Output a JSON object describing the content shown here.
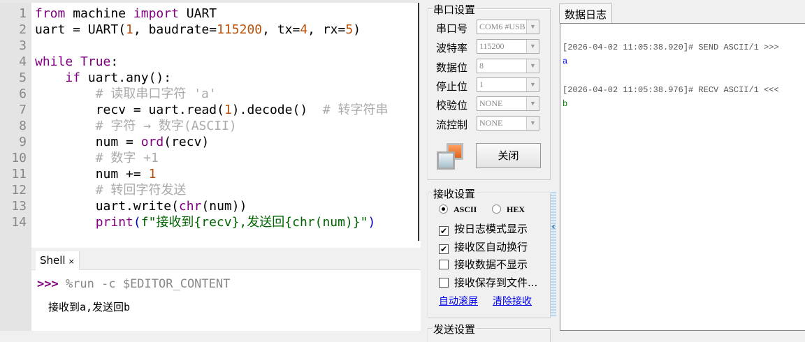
{
  "editor": {
    "line_numbers": [
      "1",
      "2",
      "3",
      "4",
      "5",
      "6",
      "7",
      "8",
      "9",
      "10",
      "11",
      "12",
      "13",
      "14"
    ],
    "code": {
      "l1": [
        "from",
        " machine ",
        "import",
        " UART"
      ],
      "l2": [
        "uart = UART(",
        "1",
        ", baudrate=",
        "115200",
        ", tx=",
        "4",
        ", rx=",
        "5",
        ")"
      ],
      "l4": [
        "while",
        " ",
        "True",
        ":"
      ],
      "l5": [
        "    ",
        "if",
        " uart.any():"
      ],
      "l6": "        # 读取串口字符 'a'",
      "l7": [
        "        recv = uart.read(",
        "1",
        ").decode()  ",
        "# 转字符串"
      ],
      "l8": "        # 字符 → 数字(ASCII)",
      "l9": [
        "        num = ",
        "ord",
        "(recv)"
      ],
      "l10": "        # 数字 +1",
      "l11": [
        "        num += ",
        "1"
      ],
      "l12": "        # 转回字符发送",
      "l13": [
        "        uart.write(",
        "chr",
        "(num))"
      ],
      "l14": [
        "        ",
        "print",
        "(",
        "f\"接收到{recv},发送回{chr(num)}\"",
        ")"
      ]
    }
  },
  "shell": {
    "tab_label": "Shell",
    "close": "×",
    "prompt": ">>>",
    "command": " %run -c $EDITOR_CONTENT",
    "output": "接收到a,发送回b"
  },
  "serial": {
    "group_port": "串口设置",
    "fields": [
      {
        "label": "串口号",
        "value": "COM6 #USB"
      },
      {
        "label": "波特率",
        "value": "115200"
      },
      {
        "label": "数据位",
        "value": "8"
      },
      {
        "label": "停止位",
        "value": "1"
      },
      {
        "label": "校验位",
        "value": "NONE"
      },
      {
        "label": "流控制",
        "value": "NONE"
      }
    ],
    "close_button": "关闭",
    "group_recv": "接收设置",
    "radios": [
      {
        "label": "ASCII",
        "checked": true
      },
      {
        "label": "HEX",
        "checked": false
      }
    ],
    "checks": [
      {
        "label": "按日志模式显示",
        "checked": true
      },
      {
        "label": "接收区自动换行",
        "checked": true
      },
      {
        "label": "接收数据不显示",
        "checked": false
      },
      {
        "label": "接收保存到文件...",
        "checked": false
      }
    ],
    "links": [
      "自动滚屏",
      "清除接收"
    ],
    "group_send": "发送设置"
  },
  "log": {
    "tab": "数据日志",
    "entries": [
      {
        "header": "[2026-04-02 11:05:38.920]# SEND ASCII/1 >>>",
        "data": "a",
        "color": "#0000ff"
      },
      {
        "header": "[2026-04-02 11:05:38.976]# RECV ASCII/1 <<<",
        "data": "b",
        "color": "#008000"
      }
    ]
  }
}
